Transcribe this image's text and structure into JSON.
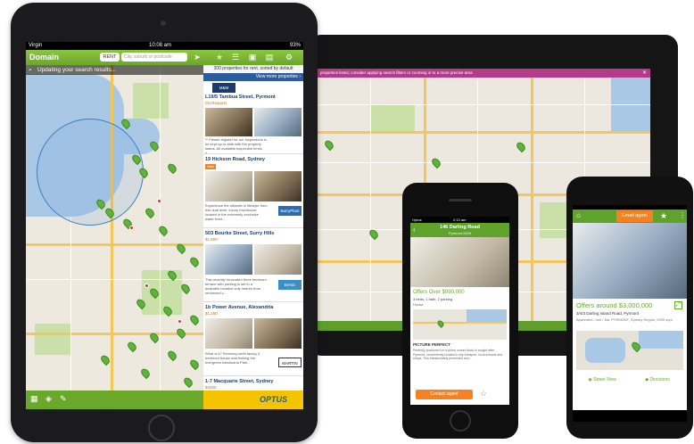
{
  "ipad": {
    "status": {
      "carrier": "Virgin",
      "time": "10:08 am",
      "battery": "93%"
    },
    "topbar": {
      "logo": "Domain",
      "rent_pill": "RENT",
      "search_placeholder": "City, suburb or postcode",
      "icons": [
        "location-arrow-icon",
        "star-icon",
        "list-icon",
        "gallery-icon",
        "save-icon",
        "gear-icon"
      ]
    },
    "map": {
      "updating_text": "Updating your search results...",
      "marker_color": "#5fb33b"
    },
    "listing": {
      "summary": "200 properties for rent, sorted by default",
      "view_more": "View more properties",
      "items": [
        {
          "title": "L19/5 Tambua Street, Pyrmont",
          "price": "On Request",
          "text": "** Please register for our inspections to be kept up to date with the property status. All available inspection times a...",
          "agency": "M&M"
        },
        {
          "title": "19 Hickson Road, Sydney",
          "price": "New",
          "text": "Experience the ultimate in lifestyle from this dual level, luxury townhouse located in the extremely exclusive water front...",
          "agency": "BarryPlant"
        },
        {
          "title": "503 Bourke Street, Surry Hills",
          "price": "$1,800",
          "text": "This recently renovated three bedroom terrace with parking is set in a desirable location only metres from renowned c...",
          "agency": "Bresic"
        },
        {
          "title": "1b Power Avenue, Alexandria",
          "price": "$1,250",
          "text": "What is it? Stunning north facing 3 bedroom house overlooking the evergreen Alexandria Park...",
          "agency": "MARTIN"
        },
        {
          "title": "1-7 Macquarie Street, Sydney",
          "price": "$2000",
          "text": "",
          "agency": ""
        }
      ],
      "sponsor": "OPTUS"
    },
    "bottom_icons": [
      "keyboard-icon",
      "layers-icon",
      "pen-icon"
    ]
  },
  "tv": {
    "banner": "properties listed, consider applying search filters or zooming in to a more precise area"
  },
  "iphone": {
    "status_carrier": "Optus",
    "status_time": "2:13 am",
    "title": "146 Darling Road",
    "subtitle": "Pyrmont 2009",
    "price": "Offers Over $990,000",
    "features": "3 beds, 1 bath, 2 parking",
    "type": "House",
    "section_title": "PICTURE PERFECT",
    "description": "Perfectly positioned on a prime corner block in sought after Pyrmont, conveniently located in city transport, local schools and shops. This immaculately presented and...",
    "contact_button": "Contact agent",
    "star": "☆"
  },
  "android": {
    "email_button": "Email agent",
    "star": "★",
    "price": "Offers around $3,000,000",
    "features": "3/4/3 Darling Island Road, Pyrmont",
    "details": "Apartment / unit / flat, PYRMONT, Sydney Region, 2009 sqm",
    "street_view": "Street View",
    "directions": "Directions"
  },
  "colors": {
    "brand_green": "#6aa82a",
    "accent_orange": "#f58220",
    "banner_pink": "#b33b8a",
    "link_blue": "#1a3f73"
  }
}
